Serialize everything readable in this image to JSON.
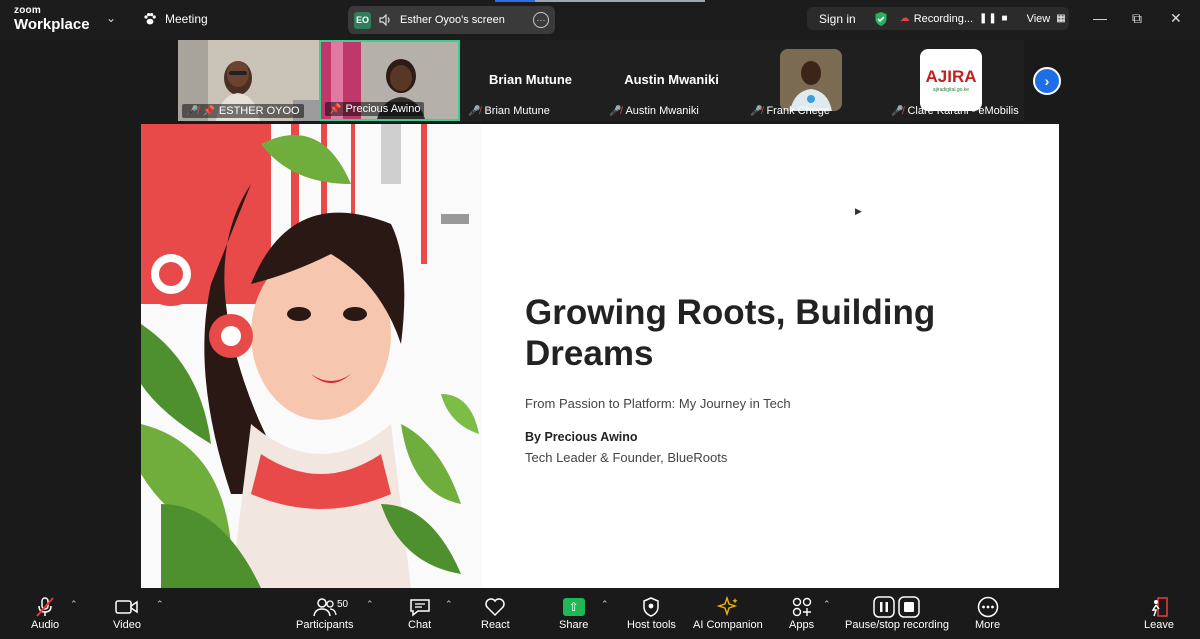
{
  "app": {
    "logo_line1": "zoom",
    "logo_line2": "Workplace",
    "meeting_label": "Meeting"
  },
  "screen_share": {
    "initials": "EO",
    "label": "Esther Oyoo's screen"
  },
  "header": {
    "sign_in": "Sign in",
    "recording": "Recording...",
    "view": "View"
  },
  "participants": [
    {
      "name": "ESTHER OYOO",
      "muted": true,
      "pinned": true,
      "type": "video"
    },
    {
      "name": "Precious Awino",
      "muted": false,
      "pinned": true,
      "type": "video",
      "selected": true
    },
    {
      "name": "Brian Mutune",
      "muted": true,
      "type": "name",
      "display": "Brian Mutune"
    },
    {
      "name": "Austin Mwaniki",
      "muted": true,
      "type": "name",
      "display": "Austin Mwaniki"
    },
    {
      "name": "Frank Chege",
      "muted": true,
      "type": "avatar"
    },
    {
      "name": "Clare Karani - eMobilis",
      "muted": true,
      "type": "logo",
      "logo_text": "AJIRA",
      "logo_sub": "ajiradigital.go.ke"
    }
  ],
  "slide": {
    "title": "Growing Roots, Building Dreams",
    "subtitle": "From Passion to Platform: My Journey in Tech",
    "author": "By Precious Awino",
    "role": "Tech Leader & Founder, BlueRoots"
  },
  "toolbar": {
    "audio": "Audio",
    "video": "Video",
    "participants": "Participants",
    "participants_count": "50",
    "chat": "Chat",
    "react": "React",
    "share": "Share",
    "host_tools": "Host tools",
    "ai_companion": "AI Companion",
    "apps": "Apps",
    "recording": "Pause/stop recording",
    "more": "More",
    "leave": "Leave"
  },
  "colors": {
    "share_green": "#1fb854",
    "next_blue": "#1e6ee8",
    "selected_border": "#3ecf8e",
    "leave_red": "#e03a3a"
  }
}
